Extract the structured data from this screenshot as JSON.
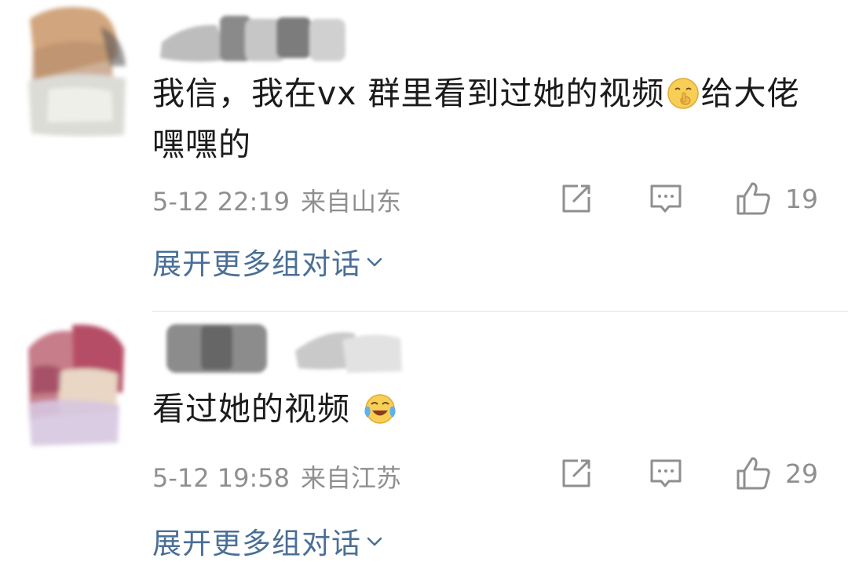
{
  "comments": [
    {
      "text": "我信，我在vx 群里看到过她的视频",
      "text_after_emoji": "给大佬嘿嘿的",
      "emoji": "shushing-face-emoji",
      "time": "5-12 22:19",
      "location": "来自山东",
      "likes": "19",
      "expand_label": "展开更多组对话"
    },
    {
      "text": "看过她的视频 ",
      "emoji": "crying-laughing-emoji",
      "time": "5-12 19:58",
      "location": "来自江苏",
      "likes": "29",
      "expand_label": "展开更多组对话"
    }
  ],
  "icons": {
    "share": "share-icon",
    "reply": "comment-icon",
    "like": "thumbs-up-icon",
    "expand": "chevron-down-icon"
  },
  "colors": {
    "text": "#1b1b1b",
    "meta": "#8f8f8f",
    "link": "#4a6f96",
    "divider": "#e3e3e3"
  }
}
